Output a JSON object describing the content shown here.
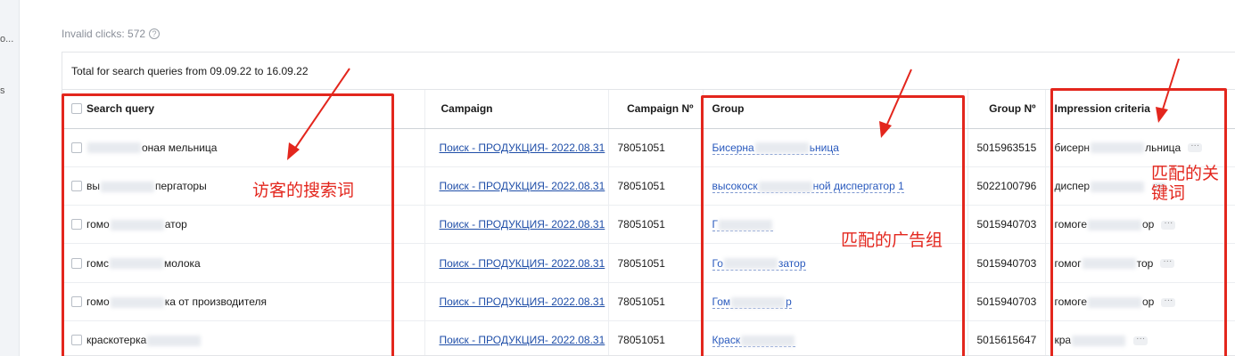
{
  "sidebar": {
    "frag1": "o...",
    "frag2": "s"
  },
  "invalid_clicks": "Invalid clicks: 572",
  "total_label": "Total for search queries from 09.09.22 to 16.09.22",
  "columns": {
    "search_query": "Search query",
    "campaign": "Campaign",
    "campaign_no": "Campaign Nº",
    "group": "Group",
    "group_no": "Group Nº",
    "impression": "Impression criteria"
  },
  "rows": [
    {
      "q1": "",
      "q2": "оная мельница",
      "campaign": "Поиск - ПРОДУКЦИЯ- 2022.08.31",
      "campaign_no": "78051051",
      "g1": "Бисерна",
      "g2": "ьница",
      "group_no": "5015963515",
      "i1": "бисерн",
      "i2": "льница"
    },
    {
      "q1": "вы",
      "q2": "пергаторы",
      "campaign": "Поиск - ПРОДУКЦИЯ- 2022.08.31",
      "campaign_no": "78051051",
      "g1": "высокоск",
      "g2": "ной диспергатор 1",
      "group_no": "5022100796",
      "i1": "диспер",
      "i2": ""
    },
    {
      "q1": "гомо",
      "q2": "атор",
      "campaign": "Поиск - ПРОДУКЦИЯ- 2022.08.31",
      "campaign_no": "78051051",
      "g1": "Г",
      "g2": "",
      "group_no": "5015940703",
      "i1": "гомоге",
      "i2": "ор"
    },
    {
      "q1": "гомс",
      "q2": "молока",
      "campaign": "Поиск - ПРОДУКЦИЯ- 2022.08.31",
      "campaign_no": "78051051",
      "g1": "Го",
      "g2": "затор",
      "group_no": "5015940703",
      "i1": "гомог",
      "i2": "тор"
    },
    {
      "q1": "гомо",
      "q2": "ка от производителя",
      "campaign": "Поиск - ПРОДУКЦИЯ- 2022.08.31",
      "campaign_no": "78051051",
      "g1": "Гом",
      "g2": "р",
      "group_no": "5015940703",
      "i1": "гомоге",
      "i2": "ор"
    },
    {
      "q1": "краскотерка",
      "q2": "",
      "campaign": "Поиск - ПРОДУКЦИЯ- 2022.08.31",
      "campaign_no": "78051051",
      "g1": "Краск",
      "g2": "",
      "group_no": "5015615647",
      "i1": "кра",
      "i2": ""
    }
  ],
  "annotations": {
    "visitor_terms": "访客的搜索词",
    "matched_group": "匹配的广告组",
    "matched_keyword_1": "匹配的关",
    "matched_keyword_2": "键词"
  },
  "colors": {
    "annotation_red": "#e3261d",
    "link_blue": "#1f4ea8"
  }
}
